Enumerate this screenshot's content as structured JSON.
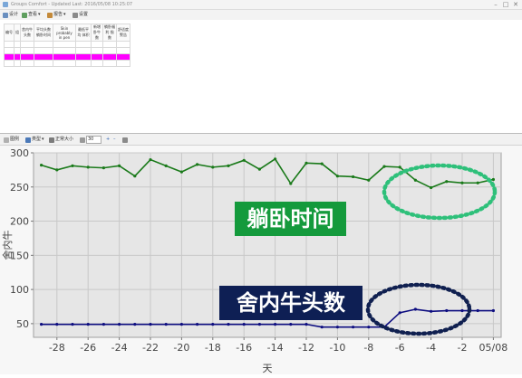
{
  "window": {
    "title": "Groups Comfort - Updated Last: 2016/05/08 10:25:07",
    "minimize": "–",
    "maximize": "□",
    "close": "✕"
  },
  "toolbar": {
    "items": [
      {
        "label": "设计",
        "icon": "design-icon"
      },
      {
        "label": "查看",
        "icon": "view-icon"
      },
      {
        "label": "报告",
        "icon": "report-icon"
      },
      {
        "label": "设置",
        "icon": "settings-icon"
      }
    ]
  },
  "table": {
    "headers": [
      "编号",
      "组",
      "舍内牛头数",
      "平均头数 躺卧时间",
      "Skin probably in pen",
      "最低平均 体积",
      "新增 卧牛数",
      "躺卧福利 指数",
      "舒适度 警告"
    ],
    "rows": [
      {
        "cells": [
          "",
          "",
          "",
          "",
          "",
          "",
          "",
          "",
          ""
        ],
        "highlight": false
      },
      {
        "cells": [
          "",
          "",
          "",
          "",
          "",
          "",
          "",
          "",
          ""
        ],
        "highlight": false
      },
      {
        "cells": [
          "",
          "",
          "",
          "",
          "",
          "",
          "",
          "",
          ""
        ],
        "highlight": true
      },
      {
        "cells": [
          "",
          "",
          "",
          "",
          "",
          "",
          "",
          "",
          ""
        ],
        "highlight": false
      }
    ]
  },
  "toolbar2": {
    "chart_label": "图例",
    "type_label": "类型",
    "size_label": "正常大小",
    "days_value": "30",
    "plus": "+",
    "minus": "–"
  },
  "annotations": {
    "lying_time": "躺卧时间",
    "cow_count": "舍内牛头数"
  },
  "colors": {
    "lying_series": "#1a7a1a",
    "cows_series": "#0d0d80",
    "lying_label_bg": "#149a3c",
    "cows_label_bg": "#0e1f54",
    "highlight_row": "#ff00ff",
    "green_ellipse": "#2ec07a",
    "navy_ellipse": "#102050"
  },
  "chart_data": {
    "type": "line",
    "xlabel": "天",
    "ylabel": "舍内牛",
    "xlim": [
      -29.5,
      0.5
    ],
    "ylim": [
      30,
      300
    ],
    "yticks": [
      50,
      100,
      150,
      200,
      250,
      300
    ],
    "xticks": [
      -28,
      -26,
      -24,
      -22,
      -20,
      -18,
      -16,
      -14,
      -12,
      -10,
      -8,
      -6,
      -4,
      -2,
      0
    ],
    "xticklabels": [
      "-28",
      "-26",
      "-24",
      "-22",
      "-20",
      "-18",
      "-16",
      "-14",
      "-12",
      "-10",
      "-8",
      "-6",
      "-4",
      "-2",
      "05/08"
    ],
    "grid": true,
    "x": [
      -29,
      -28,
      -27,
      -26,
      -25,
      -24,
      -23,
      -22,
      -21,
      -20,
      -19,
      -18,
      -17,
      -16,
      -15,
      -14,
      -13,
      -12,
      -11,
      -10,
      -9,
      -8,
      -7,
      -6,
      -5,
      -4,
      -3,
      -2,
      -1,
      0
    ],
    "series": [
      {
        "name": "躺卧时间",
        "values": [
          282,
          275,
          281,
          279,
          278,
          281,
          266,
          290,
          281,
          272,
          283,
          279,
          281,
          289,
          276,
          291,
          255,
          285,
          284,
          266,
          265,
          260,
          280,
          279,
          260,
          249,
          258,
          256,
          256,
          261
        ]
      },
      {
        "name": "舍内牛头数",
        "values": [
          49,
          49,
          49,
          49,
          49,
          49,
          49,
          49,
          49,
          49,
          49,
          49,
          49,
          49,
          49,
          49,
          49,
          49,
          45,
          45,
          45,
          45,
          45,
          66,
          71,
          68,
          69,
          69,
          69,
          69
        ]
      }
    ]
  }
}
